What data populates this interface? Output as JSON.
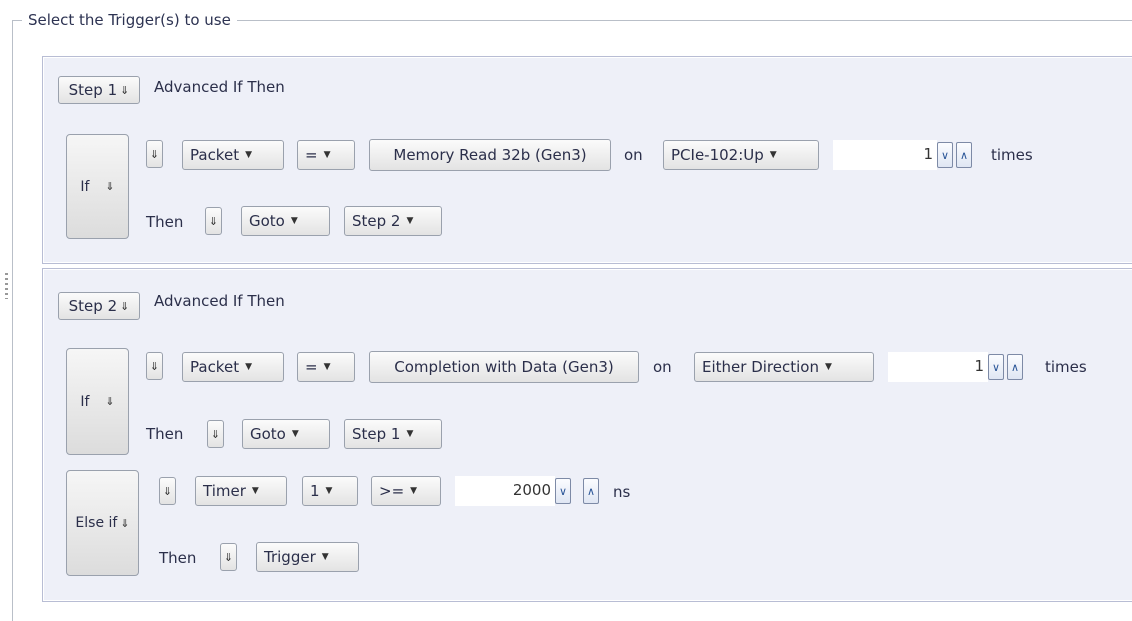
{
  "group_title": "Select the Trigger(s) to use",
  "step1": {
    "step_label": "Step 1",
    "mode": "Advanced If Then",
    "if_label": "If",
    "condition": {
      "type": "Packet",
      "operator": "=",
      "packet": "Memory Read 32b (Gen3)",
      "on_label": "on",
      "link": "PCIe-102:Up",
      "count": "1",
      "times_label": "times"
    },
    "then_label": "Then",
    "action": "Goto",
    "target": "Step 2"
  },
  "step2": {
    "step_label": "Step 2",
    "mode": "Advanced If Then",
    "if_label": "If",
    "condition": {
      "type": "Packet",
      "operator": "=",
      "packet": "Completion with Data (Gen3)",
      "on_label": "on",
      "link": "Either Direction",
      "count": "1",
      "times_label": "times"
    },
    "then_label": "Then",
    "action": "Goto",
    "target": "Step 1",
    "else_if_label": "Else if",
    "else_condition": {
      "type": "Timer",
      "timer_index": "1",
      "operator": ">=",
      "value": "2000",
      "unit": "ns"
    },
    "else_then_label": "Then",
    "else_action": "Trigger"
  },
  "icons": {
    "expand": "double-chevron-down-icon",
    "dropdown": "triangle-down-icon",
    "spin_down": "chevron-down-icon",
    "spin_up": "chevron-up-icon"
  }
}
